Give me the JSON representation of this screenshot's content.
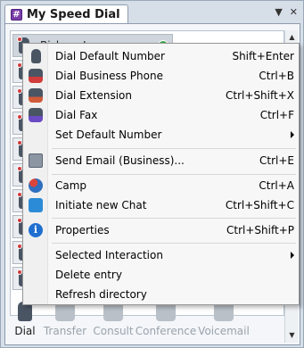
{
  "window": {
    "tab_title": "My Speed Dial",
    "tab_icon": "speed-dial-icon"
  },
  "list": {
    "first_contact_name": "Bishop, Lea"
  },
  "toolbar": {
    "dial_label": "Dial",
    "transfer_label": "Transfer",
    "consult_label": "Consult",
    "conference_label": "Conference",
    "voicemail_label": "Voicemail"
  },
  "menu": {
    "items": [
      {
        "label": "Dial Default Number",
        "shortcut": "Shift+Enter",
        "icon": "dial-icon"
      },
      {
        "label": "Dial Business Phone",
        "shortcut": "Ctrl+B",
        "icon": "business-phone-icon"
      },
      {
        "label": "Dial Extension",
        "shortcut": "Ctrl+Shift+X",
        "icon": "extension-icon"
      },
      {
        "label": "Dial Fax",
        "shortcut": "Ctrl+F",
        "icon": "fax-icon"
      },
      {
        "label": "Set Default Number",
        "shortcut": "",
        "icon": "",
        "submenu": true
      },
      {
        "label": "Send Email (Business)...",
        "shortcut": "Ctrl+E",
        "icon": "email-icon"
      },
      {
        "label": "Camp",
        "shortcut": "Ctrl+A",
        "icon": "camp-icon"
      },
      {
        "label": "Initiate new Chat",
        "shortcut": "Ctrl+Shift+C",
        "icon": "chat-icon"
      },
      {
        "label": "Properties",
        "shortcut": "Ctrl+Shift+P",
        "icon": "info-icon"
      },
      {
        "label": "Selected Interaction",
        "shortcut": "",
        "icon": "",
        "submenu": true
      },
      {
        "label": "Delete entry",
        "shortcut": "",
        "icon": ""
      },
      {
        "label": "Refresh directory",
        "shortcut": "",
        "icon": ""
      }
    ]
  },
  "colors": {
    "accent_purple": "#7a3ea8",
    "status_green": "#3aa84a",
    "status_red": "#d23b3b",
    "info_blue": "#1f6fd0"
  }
}
